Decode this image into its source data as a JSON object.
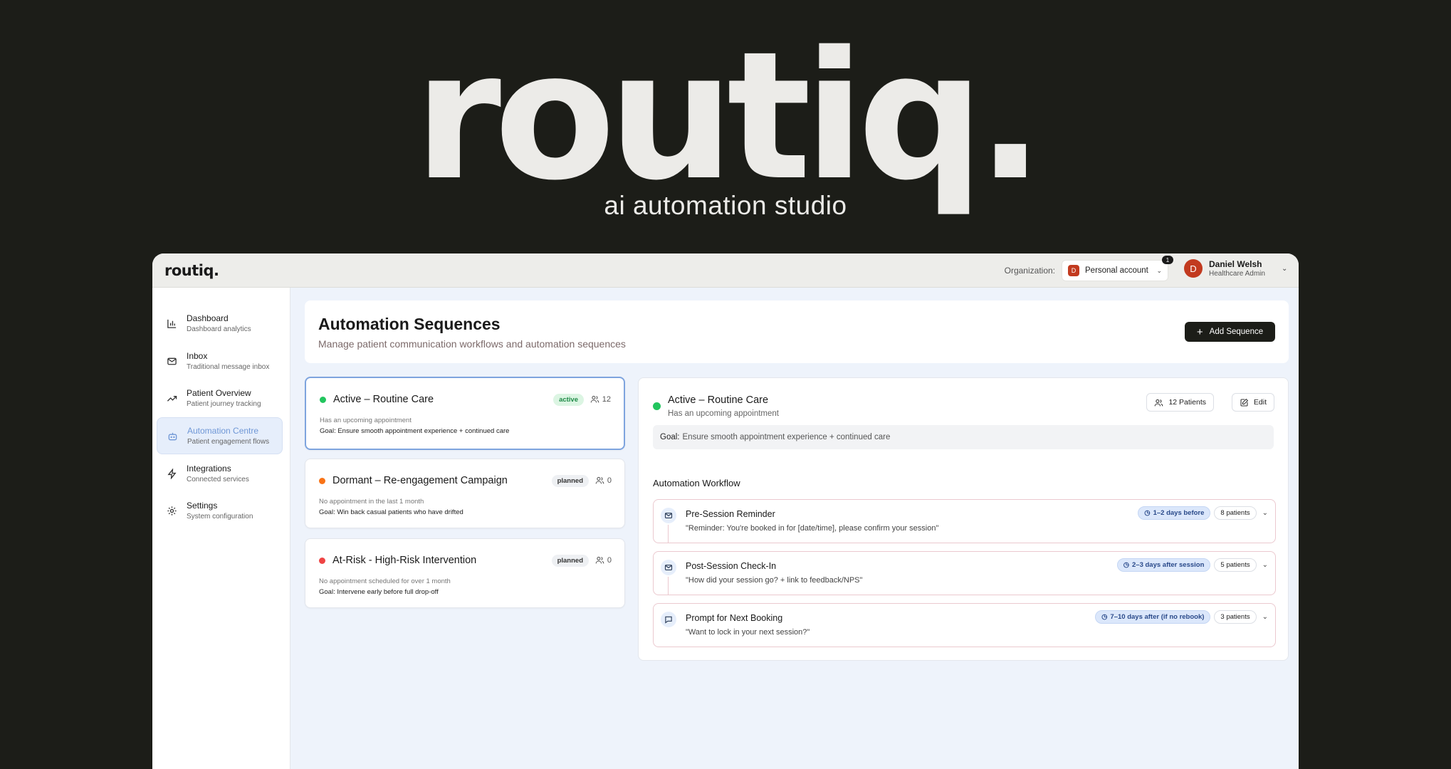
{
  "hero": {
    "logo": "routiq.",
    "tagline": "ai automation studio"
  },
  "topbar": {
    "logo": "routiq.",
    "org_label": "Organization:",
    "org_avatar": "D",
    "org_name": "Personal account",
    "notification_count": "1",
    "user_avatar": "D",
    "user_name": "Daniel Welsh",
    "user_role": "Healthcare Admin"
  },
  "sidebar": {
    "items": [
      {
        "title": "Dashboard",
        "subtitle": "Dashboard analytics",
        "icon": "bar-chart-icon"
      },
      {
        "title": "Inbox",
        "subtitle": "Traditional message inbox",
        "icon": "mail-icon"
      },
      {
        "title": "Patient Overview",
        "subtitle": "Patient journey tracking",
        "icon": "trending-up-icon"
      },
      {
        "title": "Automation Centre",
        "subtitle": "Patient engagement flows",
        "icon": "bot-icon",
        "active": true
      },
      {
        "title": "Integrations",
        "subtitle": "Connected services",
        "icon": "lightning-icon"
      },
      {
        "title": "Settings",
        "subtitle": "System configuration",
        "icon": "gear-icon"
      }
    ]
  },
  "header": {
    "title": "Automation Sequences",
    "subtitle": "Manage patient communication workflows and automation sequences",
    "add_button": "Add Sequence"
  },
  "sequences": [
    {
      "title": "Active – Routine Care",
      "status": "active",
      "count": "12",
      "condition": "Has an upcoming appointment",
      "goal": "Goal: Ensure smooth appointment experience + continued care",
      "dot_color": "#22c55e"
    },
    {
      "title": "Dormant – Re-engagement Campaign",
      "status": "planned",
      "count": "0",
      "condition": "No appointment in the last 1 month",
      "goal": "Goal: Win back casual patients who have drifted",
      "dot_color": "#f97316"
    },
    {
      "title": "At-Risk - High-Risk Intervention",
      "status": "planned",
      "count": "0",
      "condition": "No appointment scheduled for over 1 month",
      "goal": "Goal: Intervene early before full drop-off",
      "dot_color": "#ef4444"
    }
  ],
  "detail": {
    "title": "Active – Routine Care",
    "subtitle": "Has an upcoming appointment",
    "patients_button": "12 Patients",
    "edit_button": "Edit",
    "goal_label": "Goal:",
    "goal_text": "Ensure smooth appointment experience + continued care",
    "workflow_label": "Automation Workflow",
    "steps": [
      {
        "title": "Pre-Session Reminder",
        "message": "\"Reminder: You're booked in for [date/time], please confirm your session\"",
        "timing": "1–2 days before",
        "patients": "8 patients",
        "icon": "mail-icon"
      },
      {
        "title": "Post-Session Check-In",
        "message": "\"How did your session go? + link to feedback/NPS\"",
        "timing": "2–3 days after session",
        "patients": "5 patients",
        "icon": "mail-icon"
      },
      {
        "title": "Prompt for Next Booking",
        "message": "\"Want to lock in your next session?\"",
        "timing": "7–10 days after (if no rebook)",
        "patients": "3 patients",
        "icon": "message-icon"
      }
    ]
  },
  "colors": {
    "background": "#1c1d18",
    "accent": "#7ea4de",
    "active_badge_bg": "#dcf5e3",
    "active_badge_text": "#1f8a47",
    "planned_badge_bg": "#eef0f3"
  }
}
